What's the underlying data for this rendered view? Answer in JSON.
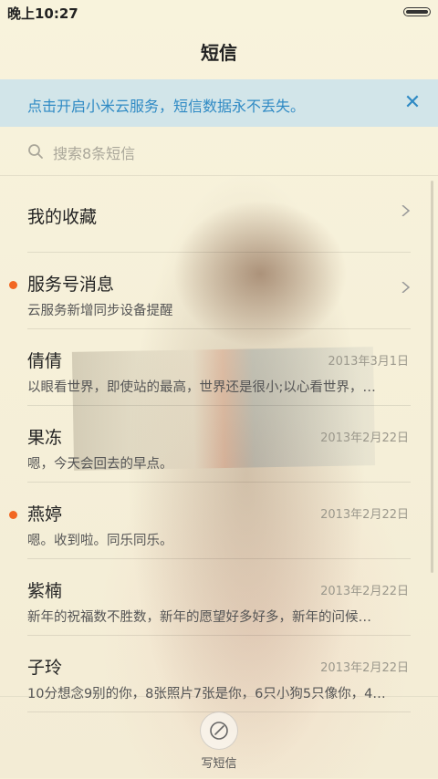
{
  "status_bar": {
    "time": "晚上10:27"
  },
  "header": {
    "title": "短信"
  },
  "banner": {
    "text": "点击开启小米云服务，短信数据永不丢失。"
  },
  "search": {
    "placeholder": "搜索8条短信"
  },
  "conversations": [
    {
      "name": "我的收藏",
      "preview": "",
      "date": "",
      "unread": false,
      "chevron": true
    },
    {
      "name": "服务号消息",
      "preview": "云服务新增同步设备提醒",
      "date": "",
      "unread": true,
      "chevron": true
    },
    {
      "name": "倩倩",
      "preview": "以眼看世界，即使站的最高，世界还是很小;以心看世界，…",
      "date": "2013年3月1日",
      "unread": false,
      "chevron": false
    },
    {
      "name": "果冻",
      "preview": "嗯，今天会回去的早点。",
      "date": "2013年2月22日",
      "unread": false,
      "chevron": false
    },
    {
      "name": "燕婷",
      "preview": "嗯。收到啦。同乐同乐。",
      "date": "2013年2月22日",
      "unread": true,
      "chevron": false
    },
    {
      "name": "紫楠",
      "preview": "新年的祝福数不胜数，新年的愿望好多好多，新年的问候…",
      "date": "2013年2月22日",
      "unread": false,
      "chevron": false
    },
    {
      "name": "子玲",
      "preview": "10分想念9别的你，8张照片7张是你，6只小狗5只像你，4…",
      "date": "2013年2月22日",
      "unread": false,
      "chevron": false
    }
  ],
  "bottom_bar": {
    "compose_label": "写短信"
  },
  "colors": {
    "accent": "#2f8ac4",
    "unread_dot": "#f26622",
    "banner_bg": "#cde3ea"
  },
  "icons": {
    "search": "search-icon",
    "close": "close-icon",
    "compose": "compose-icon",
    "chevron": "chevron-right-icon"
  }
}
